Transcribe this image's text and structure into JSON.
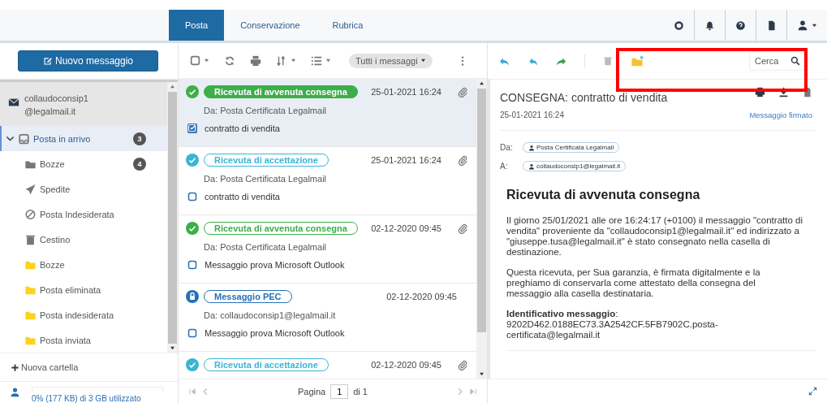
{
  "header": {
    "tabs": [
      {
        "label": "Posta",
        "selected": true
      },
      {
        "label": "Conservazione",
        "selected": false
      },
      {
        "label": "Rubrica",
        "selected": false
      }
    ]
  },
  "sidebar": {
    "new_button": "Nuovo messaggio",
    "account": {
      "lines": [
        "collaudoconsip1",
        "@legalmail.it"
      ]
    },
    "folders": [
      {
        "label": "Posta in arrivo",
        "kind": "inbox",
        "count": "3",
        "selected": true,
        "expanded": true,
        "children": [
          {
            "label": "Bozze",
            "kind": "drafts",
            "count": "4",
            "selected": false
          },
          {
            "label": "Spedite",
            "kind": "sent",
            "selected": false
          },
          {
            "label": "Posta Indesiderata",
            "kind": "spam",
            "selected": false
          },
          {
            "label": "Cestino",
            "kind": "trash",
            "selected": false
          },
          {
            "label": "Bozze",
            "kind": "folder",
            "selected": false
          },
          {
            "label": "Posta eliminata",
            "kind": "folder",
            "selected": false
          },
          {
            "label": "Posta indesiderata",
            "kind": "folder",
            "selected": false
          },
          {
            "label": "Posta inviata",
            "kind": "folder",
            "selected": false
          }
        ]
      }
    ],
    "new_folder": "Nuova cartella",
    "storage": {
      "text": "0% (177 KB) di 3 GB utilizzato",
      "level": 0
    }
  },
  "list_toolbar": {
    "filter": "Tutti i messaggi"
  },
  "messages": [
    {
      "kind": "delivered",
      "badge": "Ricevuta di avvenuta consegna",
      "date": "25-01-2021 16:24",
      "attachment": true,
      "from": "Da: Posta Certificata Legalmail",
      "subject": "contratto di vendita",
      "selected": true,
      "checked": true
    },
    {
      "kind": "accepted",
      "badge": "Ricevuta di accettazione",
      "date": "25-01-2021 16:24",
      "attachment": true,
      "from": "Da: Posta Certificata Legalmail",
      "subject": "contratto di vendita",
      "selected": false,
      "checked": false
    },
    {
      "kind": "delivered",
      "badge": "Ricevuta di avvenuta consegna",
      "date": "02-12-2020 09:45",
      "attachment": true,
      "from": "Da: Posta Certificata Legalmail",
      "subject": "Messaggio prova Microsoft Outlook",
      "selected": false,
      "checked": false
    },
    {
      "kind": "pec",
      "badge": "Messaggio PEC",
      "date": "02-12-2020 09:45",
      "attachment": false,
      "from": "Da: collaudoconsip1@legalmail.it",
      "subject": "Messaggio prova Microsoft Outlook",
      "selected": false,
      "checked": false
    },
    {
      "kind": "accepted",
      "badge": "Ricevuta di accettazione",
      "date": "02-12-2020 09:45",
      "attachment": true,
      "selected": false
    }
  ],
  "pager": {
    "label": "Pagina",
    "page": "1",
    "total": "di 1"
  },
  "search": {
    "placeholder": "Cerca"
  },
  "message": {
    "title": "CONSEGNA: contratto di vendita",
    "date": "25-01-2021 16:24",
    "signed": "Messaggio firmato",
    "from_label": "Da:",
    "from": "Posta Certificata Legalmail",
    "to_label": "A:",
    "to": "collaudoconsip1@legalmail.it",
    "heading": "Ricevuta di avvenuta consegna",
    "paragraphs": [
      "Il giorno 25/01/2021 alle ore 16:24:17 (+0100) il messaggio \"contratto di vendita\" proveniente da \"collaudoconsip1@legalmail.it\" ed indirizzato a \"giuseppe.tusa@legalmail.it\" è stato consegnato nella casella di destinazione.",
      "Questa ricevuta, per Sua garanzia, è firmata digitalmente e la preghiamo di conservarla come attestato della consegna del messaggio alla casella destinataria.",
      "**Identificativo messaggio**: 9202D462.0188EC73.3A2542CF.5FB7902C.posta-certificata@legalmail.it"
    ]
  }
}
